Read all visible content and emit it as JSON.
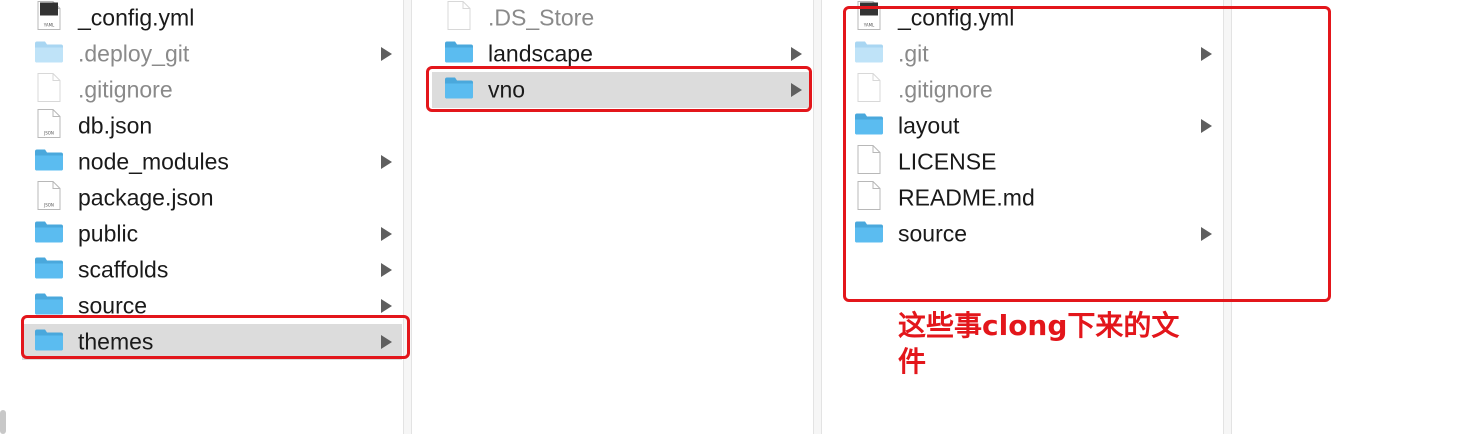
{
  "columns": [
    {
      "items": [
        {
          "label": "_config.yml",
          "icon": "yaml-file-icon",
          "kind": "yaml",
          "dim": false,
          "chevron": false,
          "selected": false
        },
        {
          "label": ".deploy_git",
          "icon": "folder-icon",
          "kind": "folder-light",
          "dim": true,
          "chevron": true,
          "selected": false
        },
        {
          "label": ".gitignore",
          "icon": "file-icon",
          "kind": "file-light",
          "dim": true,
          "chevron": false,
          "selected": false
        },
        {
          "label": "db.json",
          "icon": "json-file-icon",
          "kind": "json",
          "dim": false,
          "chevron": false,
          "selected": false
        },
        {
          "label": "node_modules",
          "icon": "folder-icon",
          "kind": "folder",
          "dim": false,
          "chevron": true,
          "selected": false
        },
        {
          "label": "package.json",
          "icon": "json-file-icon",
          "kind": "json",
          "dim": false,
          "chevron": false,
          "selected": false
        },
        {
          "label": "public",
          "icon": "folder-icon",
          "kind": "folder",
          "dim": false,
          "chevron": true,
          "selected": false
        },
        {
          "label": "scaffolds",
          "icon": "folder-icon",
          "kind": "folder",
          "dim": false,
          "chevron": true,
          "selected": false
        },
        {
          "label": "source",
          "icon": "folder-icon",
          "kind": "folder",
          "dim": false,
          "chevron": true,
          "selected": false
        },
        {
          "label": "themes",
          "icon": "folder-icon",
          "kind": "folder",
          "dim": false,
          "chevron": true,
          "selected": true
        }
      ]
    },
    {
      "items": [
        {
          "label": ".DS_Store",
          "icon": "file-icon",
          "kind": "file-light",
          "dim": true,
          "chevron": false,
          "selected": false
        },
        {
          "label": "landscape",
          "icon": "folder-icon",
          "kind": "folder",
          "dim": false,
          "chevron": true,
          "selected": false
        },
        {
          "label": "vno",
          "icon": "folder-icon",
          "kind": "folder",
          "dim": false,
          "chevron": true,
          "selected": true
        }
      ]
    },
    {
      "items": [
        {
          "label": "_config.yml",
          "icon": "yaml-file-icon",
          "kind": "yaml",
          "dim": false,
          "chevron": false,
          "selected": false
        },
        {
          "label": ".git",
          "icon": "folder-icon",
          "kind": "folder-light",
          "dim": true,
          "chevron": true,
          "selected": false
        },
        {
          "label": ".gitignore",
          "icon": "file-icon",
          "kind": "file-light",
          "dim": true,
          "chevron": false,
          "selected": false
        },
        {
          "label": "layout",
          "icon": "folder-icon",
          "kind": "folder",
          "dim": false,
          "chevron": true,
          "selected": false
        },
        {
          "label": "LICENSE",
          "icon": "file-icon",
          "kind": "file",
          "dim": false,
          "chevron": false,
          "selected": false
        },
        {
          "label": "README.md",
          "icon": "file-icon",
          "kind": "file",
          "dim": false,
          "chevron": false,
          "selected": false
        },
        {
          "label": "source",
          "icon": "folder-icon",
          "kind": "folder",
          "dim": false,
          "chevron": true,
          "selected": false
        }
      ]
    }
  ],
  "annotation": {
    "text": "这些事clong下来的文件"
  },
  "colors": {
    "highlight_red": "#e3161b",
    "folder_blue": "#5bbcf0",
    "selection_gray": "#dcdcdc"
  }
}
